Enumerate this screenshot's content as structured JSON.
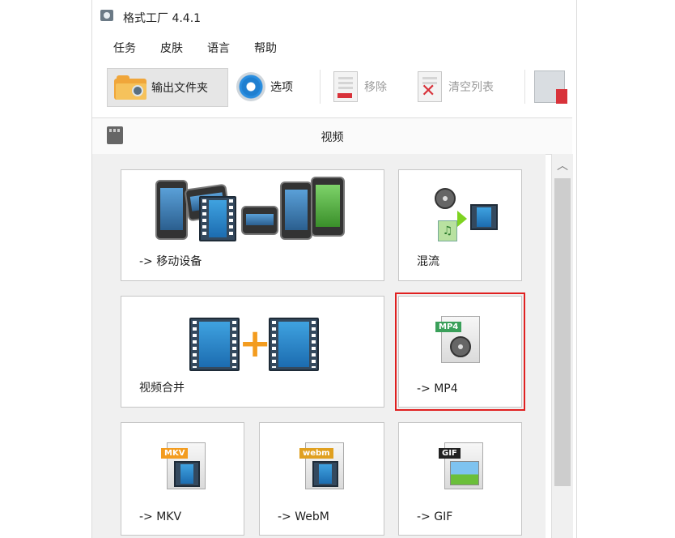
{
  "window": {
    "title": "格式工厂 4.4.1"
  },
  "menu": {
    "items": [
      "任务",
      "皮肤",
      "语言",
      "帮助"
    ]
  },
  "toolbar": {
    "output_folder": "输出文件夹",
    "options": "选项",
    "remove": "移除",
    "clear_list": "清空列表"
  },
  "section": {
    "title": "视频"
  },
  "cards": [
    {
      "label": "-> 移动设备",
      "icon": "mobile-devices-icon"
    },
    {
      "label": "混流",
      "icon": "mux-icon"
    },
    {
      "label": "视频合并",
      "icon": "video-join-icon"
    },
    {
      "label": "-> MP4",
      "icon": "mp4-file-icon",
      "selected": true
    },
    {
      "label": "-> MKV",
      "icon": "mkv-file-icon"
    },
    {
      "label": "-> WebM",
      "icon": "webm-file-icon"
    },
    {
      "label": "-> GIF",
      "icon": "gif-file-icon"
    }
  ],
  "file_tags": {
    "mp4": "MP4",
    "mkv": "MKV",
    "webm": "webm",
    "gif": "GIF"
  },
  "colors": {
    "selection": "#e02020",
    "accent_orange": "#f39c1f"
  }
}
